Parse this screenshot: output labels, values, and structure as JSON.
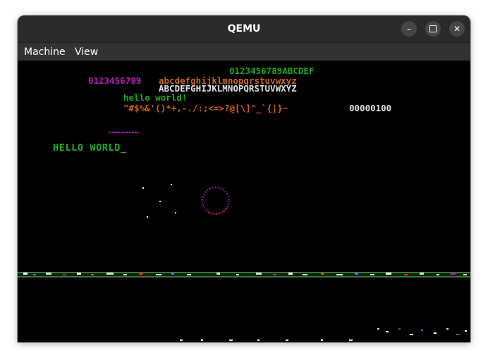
{
  "window": {
    "title": "QEMU"
  },
  "menubar": {
    "items": [
      {
        "label": "Machine"
      },
      {
        "label": "View"
      }
    ]
  },
  "screen": {
    "line1": "0123456789ABCDEF",
    "line2a": "0123456789",
    "line2b": "abcdefghijklmnopqrstuvwxyz",
    "line3": "ABCDEFGHIJKLMNOPQRSTUVWXYZ",
    "line4": "hello world!",
    "line5": "\"#$%&'()*+,-./:;<=>?@[\\]^_`{|}~",
    "counter": "00000100",
    "hello_prompt": "HELLO WORLD_"
  },
  "colors": {
    "green": "#22a822",
    "magenta": "#b41eb4",
    "orange": "#c8641e",
    "white": "#e0e0e0",
    "titlebar": "#2b2b2b",
    "menubar": "#333333"
  },
  "icons": [
    "minimize-icon",
    "maximize-icon",
    "close-icon"
  ]
}
